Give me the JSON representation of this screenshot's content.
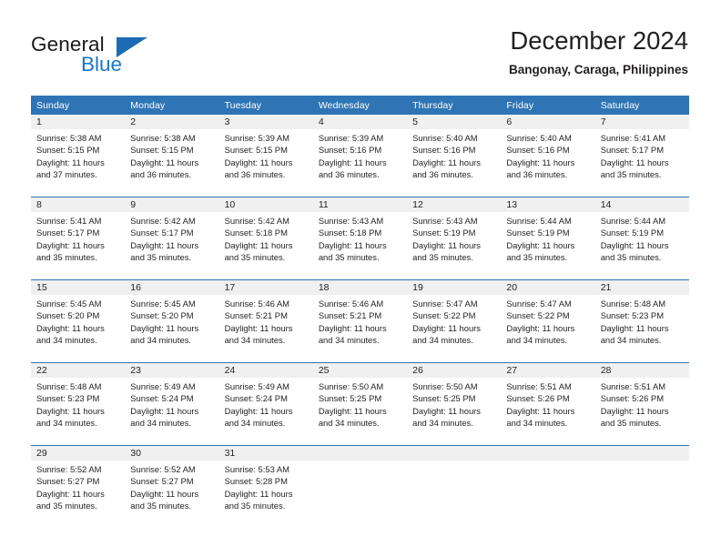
{
  "brand": {
    "name_part1": "General",
    "name_part2": "Blue",
    "flag_icon": "triangle-flag-icon",
    "accent_color": "#1b6cb5"
  },
  "header": {
    "title": "December 2024",
    "subtitle": "Bangonay, Caraga, Philippines"
  },
  "calendar": {
    "header_bg": "#2f75b5",
    "daynum_bg": "#f0f0f0",
    "weekday_labels": [
      "Sunday",
      "Monday",
      "Tuesday",
      "Wednesday",
      "Thursday",
      "Friday",
      "Saturday"
    ],
    "weeks": [
      [
        {
          "day": "1",
          "sunrise": "Sunrise: 5:38 AM",
          "sunset": "Sunset: 5:15 PM",
          "daylight1": "Daylight: 11 hours",
          "daylight2": "and 37 minutes."
        },
        {
          "day": "2",
          "sunrise": "Sunrise: 5:38 AM",
          "sunset": "Sunset: 5:15 PM",
          "daylight1": "Daylight: 11 hours",
          "daylight2": "and 36 minutes."
        },
        {
          "day": "3",
          "sunrise": "Sunrise: 5:39 AM",
          "sunset": "Sunset: 5:15 PM",
          "daylight1": "Daylight: 11 hours",
          "daylight2": "and 36 minutes."
        },
        {
          "day": "4",
          "sunrise": "Sunrise: 5:39 AM",
          "sunset": "Sunset: 5:16 PM",
          "daylight1": "Daylight: 11 hours",
          "daylight2": "and 36 minutes."
        },
        {
          "day": "5",
          "sunrise": "Sunrise: 5:40 AM",
          "sunset": "Sunset: 5:16 PM",
          "daylight1": "Daylight: 11 hours",
          "daylight2": "and 36 minutes."
        },
        {
          "day": "6",
          "sunrise": "Sunrise: 5:40 AM",
          "sunset": "Sunset: 5:16 PM",
          "daylight1": "Daylight: 11 hours",
          "daylight2": "and 36 minutes."
        },
        {
          "day": "7",
          "sunrise": "Sunrise: 5:41 AM",
          "sunset": "Sunset: 5:17 PM",
          "daylight1": "Daylight: 11 hours",
          "daylight2": "and 35 minutes."
        }
      ],
      [
        {
          "day": "8",
          "sunrise": "Sunrise: 5:41 AM",
          "sunset": "Sunset: 5:17 PM",
          "daylight1": "Daylight: 11 hours",
          "daylight2": "and 35 minutes."
        },
        {
          "day": "9",
          "sunrise": "Sunrise: 5:42 AM",
          "sunset": "Sunset: 5:17 PM",
          "daylight1": "Daylight: 11 hours",
          "daylight2": "and 35 minutes."
        },
        {
          "day": "10",
          "sunrise": "Sunrise: 5:42 AM",
          "sunset": "Sunset: 5:18 PM",
          "daylight1": "Daylight: 11 hours",
          "daylight2": "and 35 minutes."
        },
        {
          "day": "11",
          "sunrise": "Sunrise: 5:43 AM",
          "sunset": "Sunset: 5:18 PM",
          "daylight1": "Daylight: 11 hours",
          "daylight2": "and 35 minutes."
        },
        {
          "day": "12",
          "sunrise": "Sunrise: 5:43 AM",
          "sunset": "Sunset: 5:19 PM",
          "daylight1": "Daylight: 11 hours",
          "daylight2": "and 35 minutes."
        },
        {
          "day": "13",
          "sunrise": "Sunrise: 5:44 AM",
          "sunset": "Sunset: 5:19 PM",
          "daylight1": "Daylight: 11 hours",
          "daylight2": "and 35 minutes."
        },
        {
          "day": "14",
          "sunrise": "Sunrise: 5:44 AM",
          "sunset": "Sunset: 5:19 PM",
          "daylight1": "Daylight: 11 hours",
          "daylight2": "and 35 minutes."
        }
      ],
      [
        {
          "day": "15",
          "sunrise": "Sunrise: 5:45 AM",
          "sunset": "Sunset: 5:20 PM",
          "daylight1": "Daylight: 11 hours",
          "daylight2": "and 34 minutes."
        },
        {
          "day": "16",
          "sunrise": "Sunrise: 5:45 AM",
          "sunset": "Sunset: 5:20 PM",
          "daylight1": "Daylight: 11 hours",
          "daylight2": "and 34 minutes."
        },
        {
          "day": "17",
          "sunrise": "Sunrise: 5:46 AM",
          "sunset": "Sunset: 5:21 PM",
          "daylight1": "Daylight: 11 hours",
          "daylight2": "and 34 minutes."
        },
        {
          "day": "18",
          "sunrise": "Sunrise: 5:46 AM",
          "sunset": "Sunset: 5:21 PM",
          "daylight1": "Daylight: 11 hours",
          "daylight2": "and 34 minutes."
        },
        {
          "day": "19",
          "sunrise": "Sunrise: 5:47 AM",
          "sunset": "Sunset: 5:22 PM",
          "daylight1": "Daylight: 11 hours",
          "daylight2": "and 34 minutes."
        },
        {
          "day": "20",
          "sunrise": "Sunrise: 5:47 AM",
          "sunset": "Sunset: 5:22 PM",
          "daylight1": "Daylight: 11 hours",
          "daylight2": "and 34 minutes."
        },
        {
          "day": "21",
          "sunrise": "Sunrise: 5:48 AM",
          "sunset": "Sunset: 5:23 PM",
          "daylight1": "Daylight: 11 hours",
          "daylight2": "and 34 minutes."
        }
      ],
      [
        {
          "day": "22",
          "sunrise": "Sunrise: 5:48 AM",
          "sunset": "Sunset: 5:23 PM",
          "daylight1": "Daylight: 11 hours",
          "daylight2": "and 34 minutes."
        },
        {
          "day": "23",
          "sunrise": "Sunrise: 5:49 AM",
          "sunset": "Sunset: 5:24 PM",
          "daylight1": "Daylight: 11 hours",
          "daylight2": "and 34 minutes."
        },
        {
          "day": "24",
          "sunrise": "Sunrise: 5:49 AM",
          "sunset": "Sunset: 5:24 PM",
          "daylight1": "Daylight: 11 hours",
          "daylight2": "and 34 minutes."
        },
        {
          "day": "25",
          "sunrise": "Sunrise: 5:50 AM",
          "sunset": "Sunset: 5:25 PM",
          "daylight1": "Daylight: 11 hours",
          "daylight2": "and 34 minutes."
        },
        {
          "day": "26",
          "sunrise": "Sunrise: 5:50 AM",
          "sunset": "Sunset: 5:25 PM",
          "daylight1": "Daylight: 11 hours",
          "daylight2": "and 34 minutes."
        },
        {
          "day": "27",
          "sunrise": "Sunrise: 5:51 AM",
          "sunset": "Sunset: 5:26 PM",
          "daylight1": "Daylight: 11 hours",
          "daylight2": "and 34 minutes."
        },
        {
          "day": "28",
          "sunrise": "Sunrise: 5:51 AM",
          "sunset": "Sunset: 5:26 PM",
          "daylight1": "Daylight: 11 hours",
          "daylight2": "and 35 minutes."
        }
      ],
      [
        {
          "day": "29",
          "sunrise": "Sunrise: 5:52 AM",
          "sunset": "Sunset: 5:27 PM",
          "daylight1": "Daylight: 11 hours",
          "daylight2": "and 35 minutes."
        },
        {
          "day": "30",
          "sunrise": "Sunrise: 5:52 AM",
          "sunset": "Sunset: 5:27 PM",
          "daylight1": "Daylight: 11 hours",
          "daylight2": "and 35 minutes."
        },
        {
          "day": "31",
          "sunrise": "Sunrise: 5:53 AM",
          "sunset": "Sunset: 5:28 PM",
          "daylight1": "Daylight: 11 hours",
          "daylight2": "and 35 minutes."
        },
        {
          "day": "",
          "sunrise": "",
          "sunset": "",
          "daylight1": "",
          "daylight2": ""
        },
        {
          "day": "",
          "sunrise": "",
          "sunset": "",
          "daylight1": "",
          "daylight2": ""
        },
        {
          "day": "",
          "sunrise": "",
          "sunset": "",
          "daylight1": "",
          "daylight2": ""
        },
        {
          "day": "",
          "sunrise": "",
          "sunset": "",
          "daylight1": "",
          "daylight2": ""
        }
      ]
    ]
  }
}
